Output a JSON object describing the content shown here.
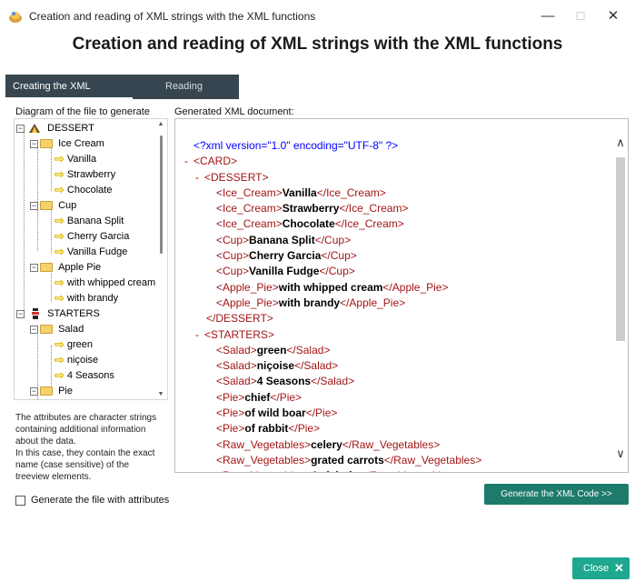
{
  "window": {
    "title": "Creation and reading of XML strings with the XML functions",
    "minimize": "—",
    "maximize": "☐",
    "close": "✕"
  },
  "heading": "Creation and reading of XML strings with the XML functions",
  "tabs": [
    {
      "label": "Creating the XML document",
      "active": true
    },
    {
      "label": "Reading",
      "active": false
    }
  ],
  "tree_label": "Diagram of the file to generate",
  "xml_label": "Generated XML document:",
  "tree": {
    "dessert": "DESSERT",
    "ice_cream": "Ice Cream",
    "vanilla": "Vanilla",
    "strawberry": "Strawberry",
    "chocolate": "Chocolate",
    "cup": "Cup",
    "banana_split": "Banana Split",
    "cherry_garcia": "Cherry Garcia",
    "vanilla_fudge": "Vanilla Fudge",
    "apple_pie": "Apple Pie",
    "whipped": "with whipped cream",
    "brandy": "with brandy",
    "starters": "STARTERS",
    "salad": "Salad",
    "green": "green",
    "nicoise": "niçoise",
    "four_seasons": "4 Seasons",
    "pie": "Pie"
  },
  "description": "The attributes are character strings containing additional information about the data.\nIn this case, they contain the exact name (case sensitive) of the treeview elements.",
  "checkbox_label": "Generate the file with attributes",
  "generate_button": "Generate the XML Code >>",
  "close_button": "Close",
  "xml": {
    "decl": "<?xml version=\"1.0\" encoding=\"UTF-8\" ?>",
    "lines": [
      {
        "indent": 0,
        "minus": "-",
        "open": "<CARD>",
        "value": "",
        "close": ""
      },
      {
        "indent": 1,
        "minus": "-",
        "open": "<DESSERT>",
        "value": "",
        "close": ""
      },
      {
        "indent": 2,
        "minus": "",
        "open": "<Ice_Cream>",
        "value": "Vanilla",
        "close": "</Ice_Cream>"
      },
      {
        "indent": 2,
        "minus": "",
        "open": "<Ice_Cream>",
        "value": "Strawberry",
        "close": "</Ice_Cream>"
      },
      {
        "indent": 2,
        "minus": "",
        "open": "<Ice_Cream>",
        "value": "Chocolate",
        "close": "</Ice_Cream>"
      },
      {
        "indent": 2,
        "minus": "",
        "open": "<Cup>",
        "value": "Banana Split",
        "close": "</Cup>"
      },
      {
        "indent": 2,
        "minus": "",
        "open": "<Cup>",
        "value": "Cherry Garcia",
        "close": "</Cup>"
      },
      {
        "indent": 2,
        "minus": "",
        "open": "<Cup>",
        "value": "Vanilla Fudge",
        "close": "</Cup>"
      },
      {
        "indent": 2,
        "minus": "",
        "open": "<Apple_Pie>",
        "value": "with whipped cream",
        "close": "</Apple_Pie>"
      },
      {
        "indent": 2,
        "minus": "",
        "open": "<Apple_Pie>",
        "value": "with brandy",
        "close": "</Apple_Pie>"
      },
      {
        "indent": 1,
        "minus": "",
        "open": "</DESSERT>",
        "value": "",
        "close": ""
      },
      {
        "indent": 1,
        "minus": "-",
        "open": "<STARTERS>",
        "value": "",
        "close": ""
      },
      {
        "indent": 2,
        "minus": "",
        "open": "<Salad>",
        "value": "green",
        "close": "</Salad>"
      },
      {
        "indent": 2,
        "minus": "",
        "open": "<Salad>",
        "value": "niçoise",
        "close": "</Salad>"
      },
      {
        "indent": 2,
        "minus": "",
        "open": "<Salad>",
        "value": "4 Seasons",
        "close": "</Salad>"
      },
      {
        "indent": 2,
        "minus": "",
        "open": "<Pie>",
        "value": "chief",
        "close": "</Pie>"
      },
      {
        "indent": 2,
        "minus": "",
        "open": "<Pie>",
        "value": "of wild boar",
        "close": "</Pie>"
      },
      {
        "indent": 2,
        "minus": "",
        "open": "<Pie>",
        "value": "of rabbit",
        "close": "</Pie>"
      },
      {
        "indent": 2,
        "minus": "",
        "open": "<Raw_Vegetables>",
        "value": "celery",
        "close": "</Raw_Vegetables>"
      },
      {
        "indent": 2,
        "minus": "",
        "open": "<Raw_Vegetables>",
        "value": "grated carrots",
        "close": "</Raw_Vegetables>"
      },
      {
        "indent": 2,
        "minus": "",
        "open": "<Raw_Vegetables>",
        "value": "Artichoke",
        "close": "</Raw_Vegetables>"
      }
    ]
  },
  "colors": {
    "accent": "#1e7b6b",
    "tab_bg": "#36454f",
    "tag": "#a31515",
    "decl": "#0000ff"
  }
}
